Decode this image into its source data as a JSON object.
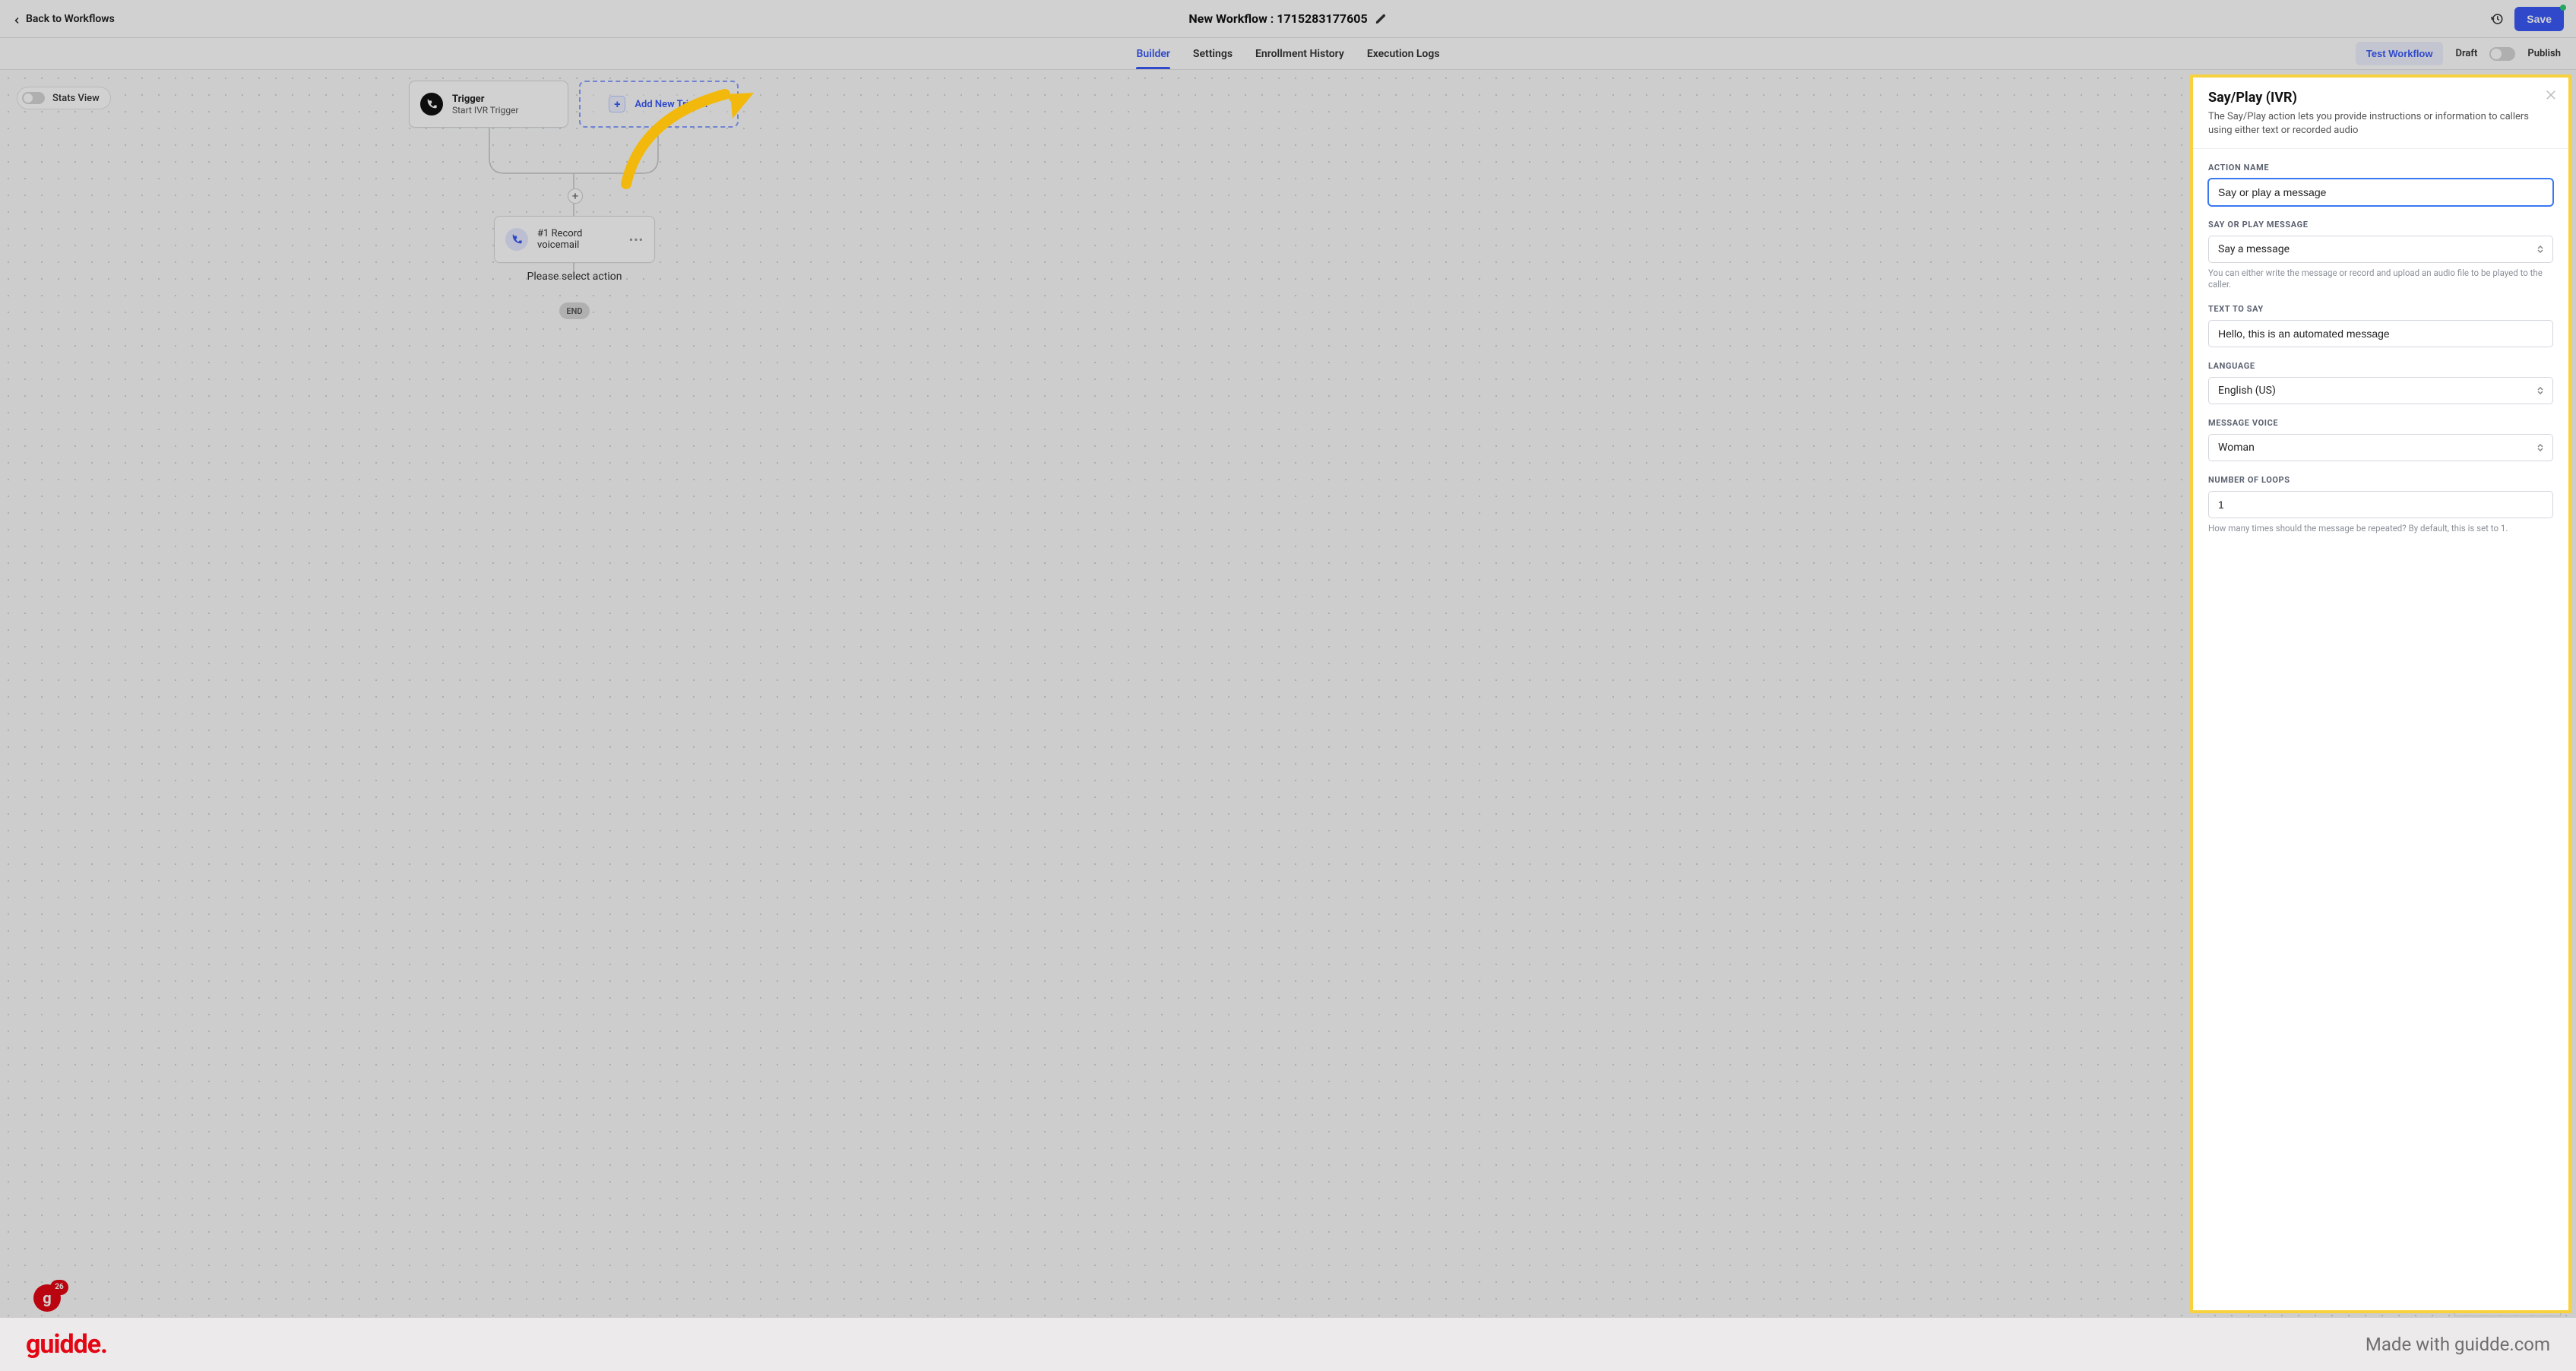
{
  "header": {
    "back_label": "Back to Workflows",
    "title": "New Workflow : 1715283177605",
    "save_label": "Save"
  },
  "tabs": {
    "builder": "Builder",
    "settings": "Settings",
    "enrollment": "Enrollment History",
    "execution": "Execution Logs",
    "test": "Test Workflow",
    "draft": "Draft",
    "publish": "Publish"
  },
  "canvas": {
    "stats_view": "Stats View",
    "trigger_title": "Trigger",
    "trigger_sub": "Start IVR Trigger",
    "add_trigger": "Add New Trigger",
    "record_label": "#1 Record voicemail",
    "select_action": "Please select action",
    "end": "END"
  },
  "panel": {
    "title": "Say/Play (IVR)",
    "desc": "The Say/Play action lets you provide instructions or information to callers using either text or recorded audio",
    "fields": {
      "action_name_label": "ACTION NAME",
      "action_name_value": "Say or play a message",
      "say_play_label": "SAY OR PLAY MESSAGE",
      "say_play_value": "Say a message",
      "say_play_hint": "You can either write the message or record and upload an audio file to be played to the caller.",
      "text_label": "TEXT TO SAY",
      "text_value": "Hello, this is an automated message",
      "lang_label": "LANGUAGE",
      "lang_value": "English (US)",
      "voice_label": "MESSAGE VOICE",
      "voice_value": "Woman",
      "loops_label": "NUMBER OF LOOPS",
      "loops_value": "1",
      "loops_hint": "How many times should the message be repeated? By default, this is set to 1."
    }
  },
  "badge_count": "26",
  "footer": {
    "logo": "guidde.",
    "made": "Made with guidde.com"
  }
}
